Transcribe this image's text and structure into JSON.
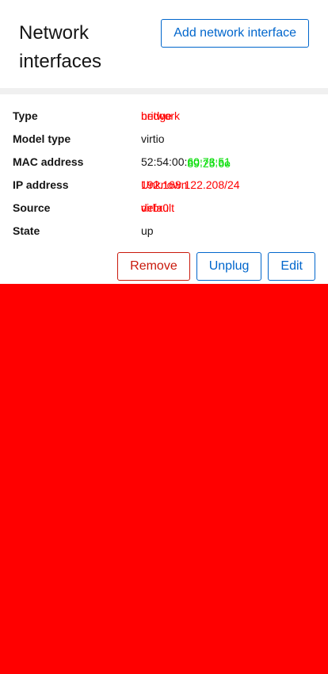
{
  "header": {
    "title": "Network interfaces",
    "add_button_label": "Add network interface"
  },
  "interface": {
    "labels": {
      "type": "Type",
      "model_type": "Model type",
      "mac": "MAC address",
      "ip": "IP address",
      "source": "Source",
      "state": "State"
    },
    "type_values": [
      "bridge",
      "network"
    ],
    "model_type": "virtio",
    "mac_prefix": "52:54:00:",
    "mac_suffixes": [
      "60:73:51",
      "89:25:6e"
    ],
    "ip_values": [
      "Unknown",
      "192.168.122.208/24"
    ],
    "source_values": [
      "virbr0",
      "default"
    ],
    "state": "up"
  },
  "actions": {
    "remove_label": "Remove",
    "unplug_label": "Unplug",
    "edit_label": "Edit"
  },
  "colors": {
    "background": "#ff0000",
    "accent": "#0066cc",
    "danger": "#c9190b",
    "overlay_red": "#ff0000",
    "overlay_green": "#00dd00"
  }
}
